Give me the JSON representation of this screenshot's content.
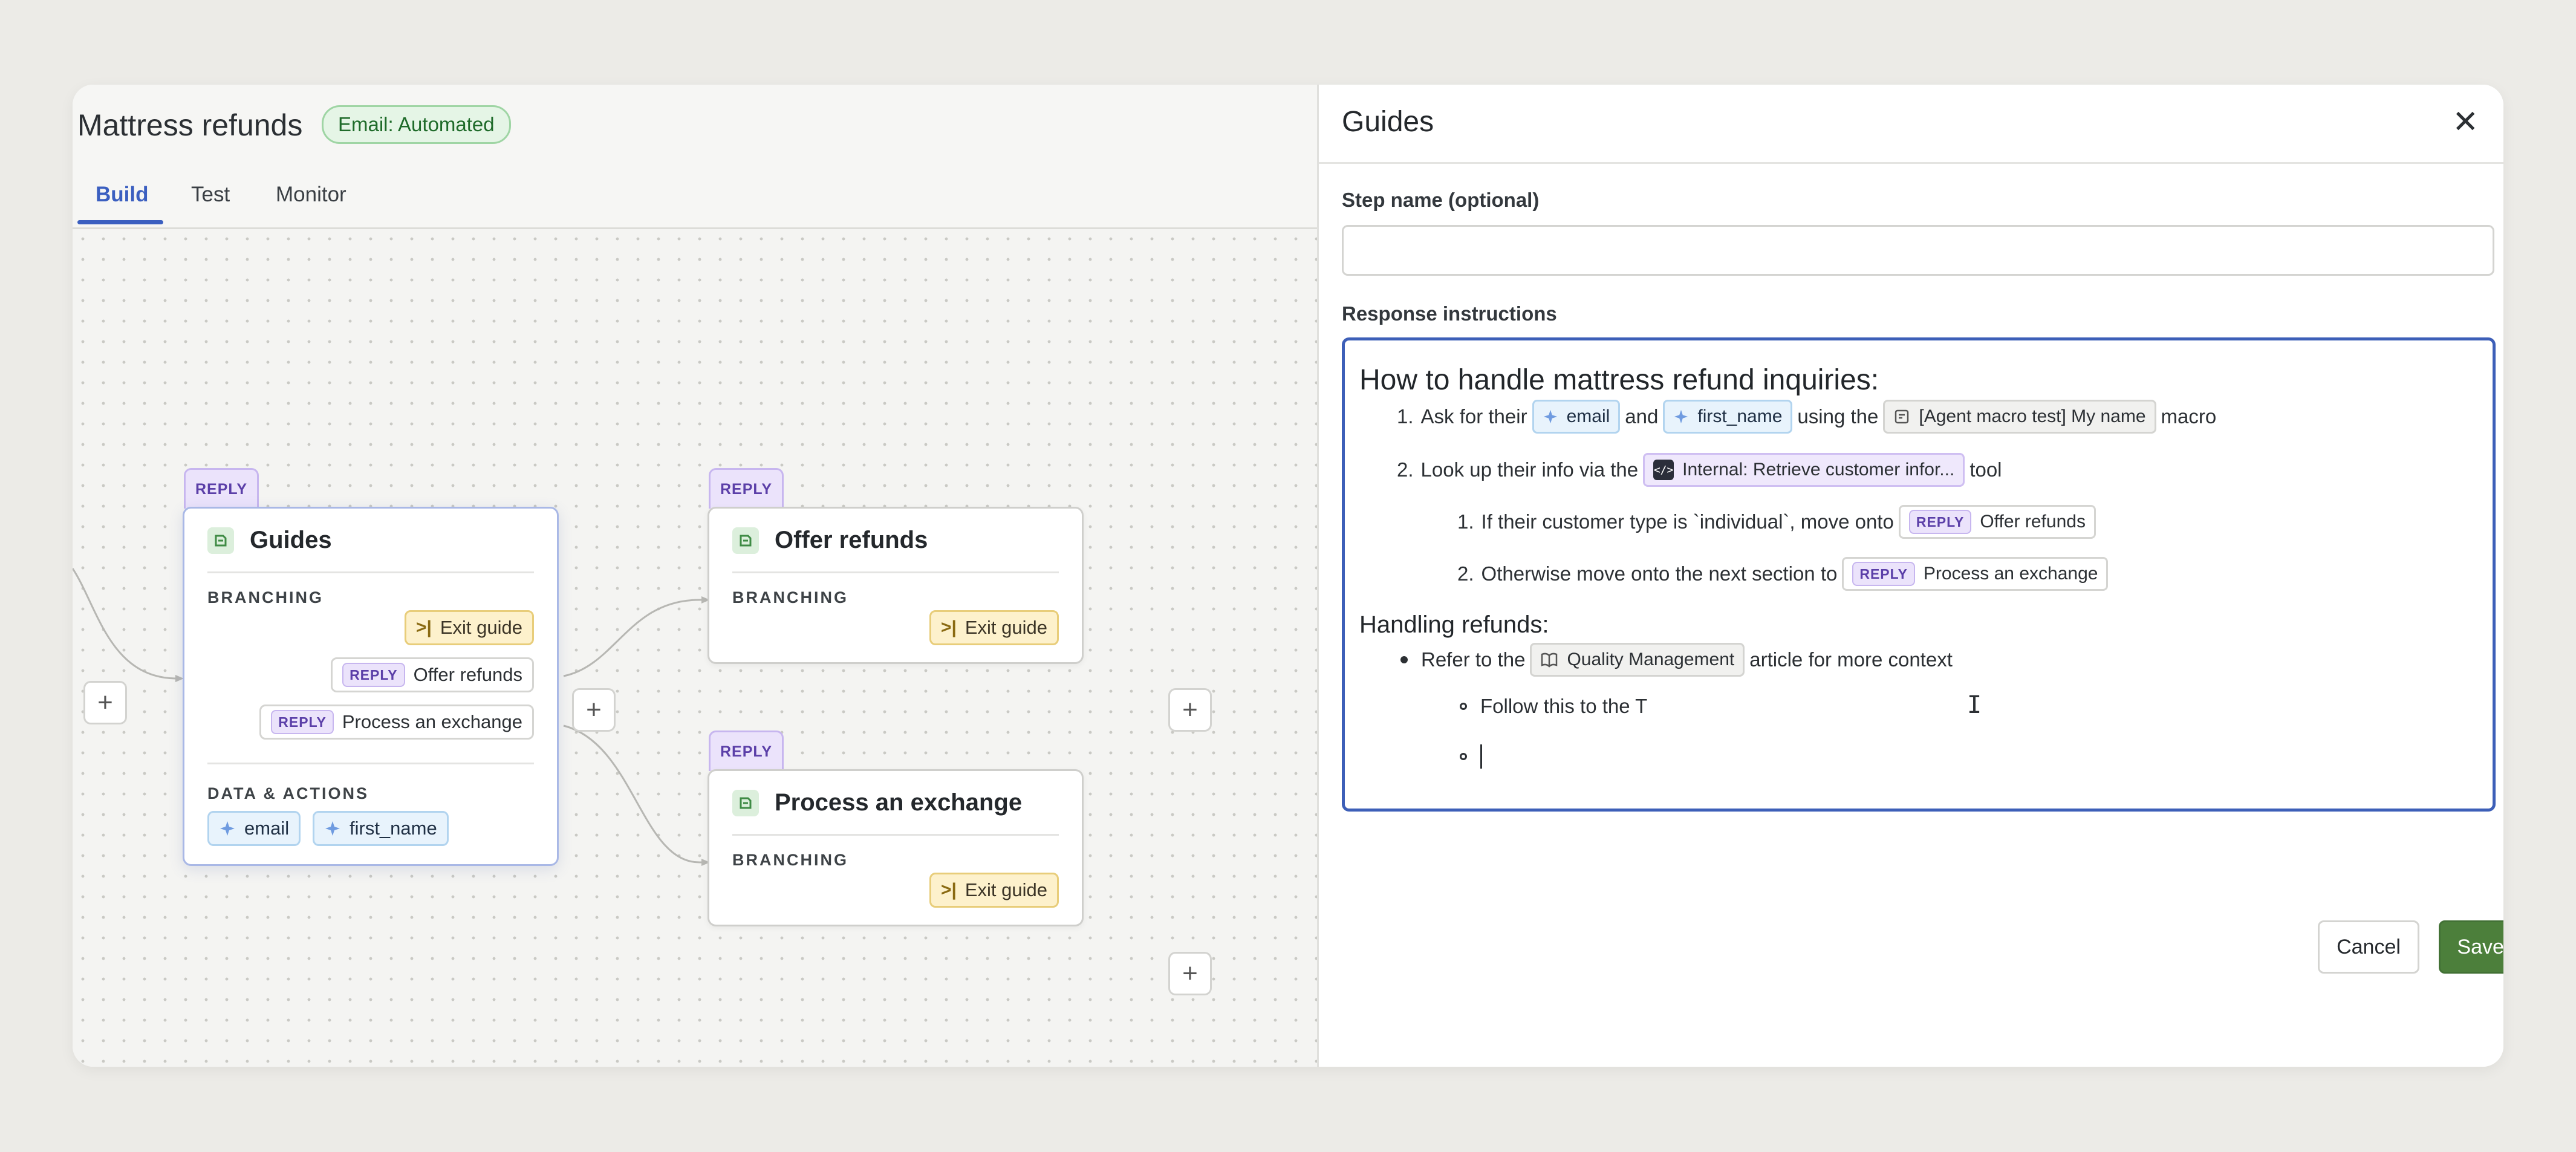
{
  "workflow": {
    "title": "Mattress refunds",
    "badge": "Email: Automated",
    "tabs": [
      {
        "label": "Build",
        "active": true
      },
      {
        "label": "Test",
        "active": false
      },
      {
        "label": "Monitor",
        "active": false
      }
    ]
  },
  "canvas": {
    "nodes": {
      "guides": {
        "tag": "REPLY",
        "title": "Guides",
        "branching_label": "BRANCHING",
        "branches": [
          {
            "type": "exit",
            "label": "Exit guide"
          },
          {
            "type": "reply",
            "tag": "REPLY",
            "label": "Offer refunds"
          },
          {
            "type": "reply",
            "tag": "REPLY",
            "label": "Process an exchange"
          }
        ],
        "data_label": "DATA & ACTIONS",
        "data_vars": [
          "email",
          "first_name"
        ]
      },
      "offer_refunds": {
        "tag": "REPLY",
        "title": "Offer refunds",
        "branching_label": "BRANCHING",
        "exit_label": "Exit guide"
      },
      "process_exchange": {
        "tag": "REPLY",
        "title": "Process an exchange",
        "branching_label": "BRANCHING",
        "exit_label": "Exit guide"
      }
    },
    "plus_glyph": "+"
  },
  "panel": {
    "title": "Guides",
    "close_glyph": "✕",
    "step_name_label": "Step name (optional)",
    "step_name_value": "",
    "instructions_label": "Response instructions",
    "editor": {
      "heading": "How to handle mattress refund inquiries:",
      "line1": {
        "num": "1.",
        "t1": "Ask for their",
        "var1": "email",
        "t2": "and",
        "var2": "first_name",
        "t3": "using the",
        "macro": "[Agent macro test] My name",
        "t4": "macro"
      },
      "line2": {
        "num": "2.",
        "t1": "Look up their info via the",
        "tool": "Internal: Retrieve customer infor...",
        "t2": "tool"
      },
      "line2a": {
        "num": "1.",
        "t1": "If their customer type is `individual`, move onto",
        "tag": "REPLY",
        "reply": "Offer refunds"
      },
      "line2b": {
        "num": "2.",
        "t1": "Otherwise move onto the next section to",
        "tag": "REPLY",
        "reply": "Process an exchange"
      },
      "heading2": "Handling refunds:",
      "bullet1": {
        "t1": "Refer to the",
        "article": "Quality Management",
        "t2": "article for more context"
      },
      "bullet1a": "Follow this to the T",
      "bullet1b": ""
    },
    "cancel_label": "Cancel",
    "save_label": "Save step"
  },
  "colors": {
    "accent_blue": "#3b5fc0",
    "save_green": "#4c7f3b",
    "reply_purple": "#5b3fa8",
    "exit_yellow": "#fdf1cc"
  }
}
